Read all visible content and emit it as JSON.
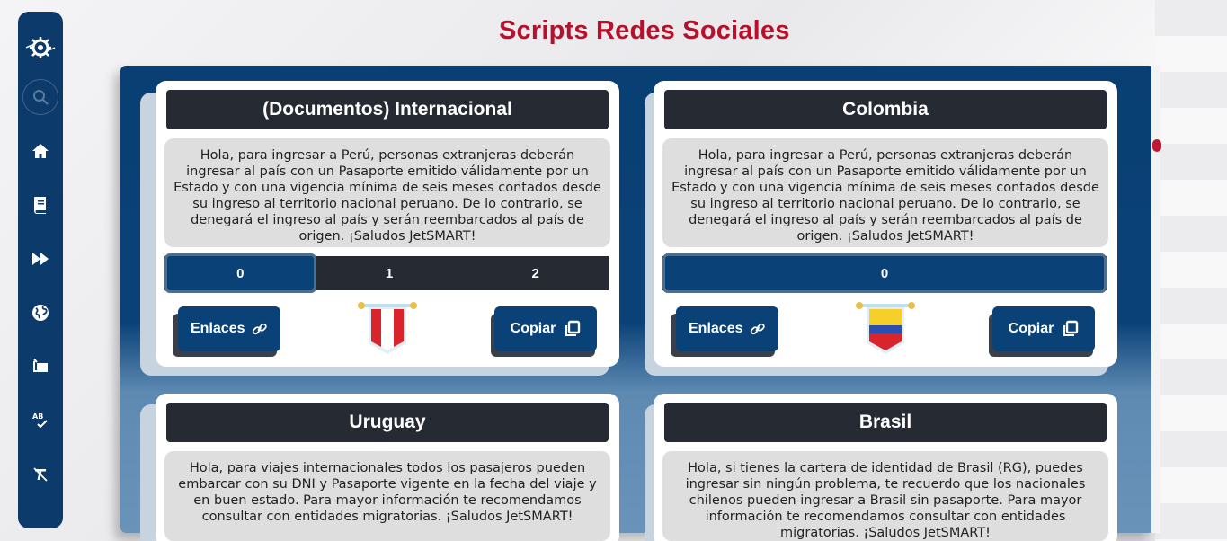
{
  "page": {
    "title": "Scripts Redes Sociales"
  },
  "sidebar": {
    "items": [
      {
        "icon": "gear-logo-icon"
      },
      {
        "icon": "search-icon"
      },
      {
        "icon": "home-icon"
      },
      {
        "icon": "book-icon"
      },
      {
        "icon": "fast-forward-icon"
      },
      {
        "icon": "globe-icon"
      },
      {
        "icon": "copy-stack-icon"
      },
      {
        "icon": "spellcheck-icon"
      },
      {
        "icon": "text-clear-icon"
      }
    ]
  },
  "cards": [
    {
      "title": "(Documentos) Internacional",
      "text": "Hola, para ingresar a Perú, personas extranjeras deberán ingresar al país con un Pasaporte emitido válidamente por un Estado y con una vigencia mínima de seis meses contados desde su ingreso al territorio nacional peruano. De lo contrario, se denegará el ingreso al país y serán reembarcados al país de origen. ¡Saludos JetSMART!",
      "tabs": [
        "0",
        "1",
        "2"
      ],
      "active_tab": "0",
      "links_label": "Enlaces",
      "copy_label": "Copiar",
      "flag": "peru-flag-icon"
    },
    {
      "title": "Colombia",
      "text": "Hola, para ingresar a Perú, personas extranjeras deberán ingresar al país con un Pasaporte emitido válidamente por un Estado y con una vigencia mínima de seis meses contados desde su ingreso al territorio nacional peruano. De lo contrario, se denegará el ingreso al país y serán reembarcados al país de origen. ¡Saludos JetSMART!",
      "tabs": [
        "0"
      ],
      "active_tab": "0",
      "links_label": "Enlaces",
      "copy_label": "Copiar",
      "flag": "colombia-flag-icon"
    },
    {
      "title": "Uruguay",
      "text": "Hola, para viajes internacionales todos los pasajeros pueden embarcar con su DNI y Pasaporte vigente en la fecha del viaje y en buen estado. Para mayor información te recomendamos consultar con entidades migratorias. ¡Saludos JetSMART!"
    },
    {
      "title": "Brasil",
      "text": "Hola, si tienes la cartera de identidad de Brasil (RG), puedes ingresar sin ningún problema, te recuerdo que los nacionales chilenos pueden ingresar a Brasil sin pasaporte. Para mayor información te recomendamos consultar con entidades migratorias. ¡Saludos JetSMART!"
    }
  ],
  "colors": {
    "accent": "#b8102a",
    "primary": "#0a4278",
    "header": "#262a33"
  }
}
